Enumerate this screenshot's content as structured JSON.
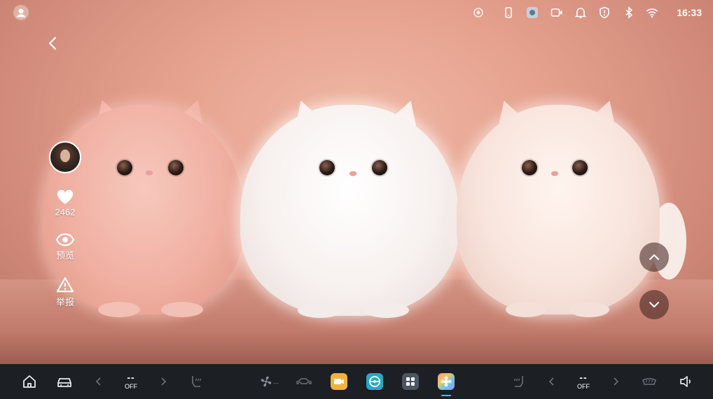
{
  "status_bar": {
    "time": "16:33",
    "icons": [
      "user-icon",
      "assistant-icon",
      "phone-icon",
      "camera-app-icon",
      "dashcam-icon",
      "bell-icon",
      "shield-icon",
      "bluetooth-icon",
      "wifi-icon"
    ]
  },
  "wallpaper": {
    "subject": "three fluffy cats",
    "colors": {
      "background": "#e5a08d",
      "cat_pink": "#f2b7ab",
      "cat_white": "#f7f1ef",
      "cat_cream": "#f8e6de"
    }
  },
  "side_actions": {
    "likes_count": "2462",
    "preview_label": "预览",
    "report_label": "举报"
  },
  "dock": {
    "left_temp": {
      "value": "--",
      "state": "OFF"
    },
    "right_temp": {
      "value": "--",
      "state": "OFF"
    },
    "fan_label": "...",
    "apps": [
      "camera-360-app",
      "steering-app",
      "apps-grid",
      "wallpaper-app"
    ],
    "active_app": "wallpaper-app",
    "accent": "#35c6e6"
  }
}
